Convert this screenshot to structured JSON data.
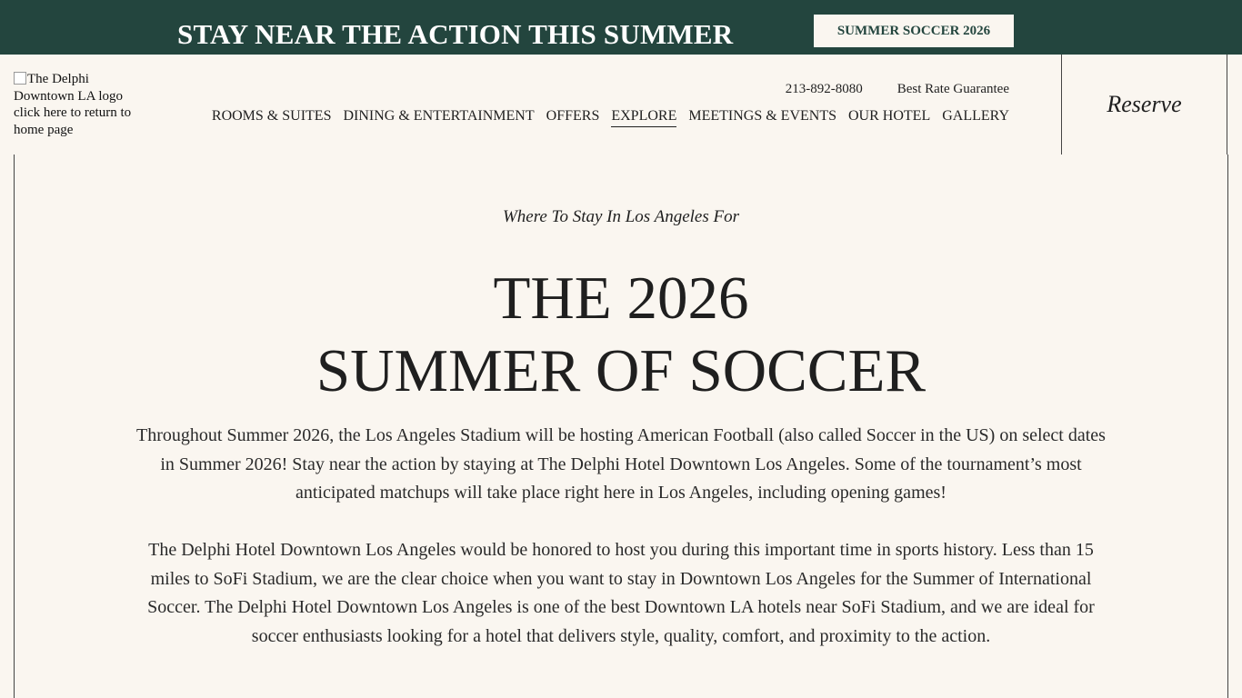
{
  "promo": {
    "headline": "STAY NEAR THE ACTION THIS SUMMER",
    "button_label": "SUMMER SOCCER 2026"
  },
  "header": {
    "logo_alt": "The Delphi Downtown LA logo click here to return to home page",
    "phone": "213-892-8080",
    "rate_link": "Best Rate Guarantee",
    "reserve_label": "Reserve"
  },
  "nav": {
    "items": [
      {
        "label": "ROOMS & SUITES"
      },
      {
        "label": "DINING & ENTERTAINMENT"
      },
      {
        "label": "OFFERS"
      },
      {
        "label": "EXPLORE"
      },
      {
        "label": "MEETINGS & EVENTS"
      },
      {
        "label": "OUR HOTEL"
      },
      {
        "label": "GALLERY"
      }
    ]
  },
  "main": {
    "eyebrow": "Where To Stay In Los Angeles For",
    "title_line1": "THE 2026",
    "title_line2": "SUMMER OF SOCCER",
    "paragraph1": "Throughout Summer 2026, the Los Angeles Stadium will be hosting American Football (also called Soccer in the US) on select dates in Summer 2026! Stay near the action by staying at The Delphi Hotel Downtown Los Angeles. Some of the tournament’s most anticipated matchups will take place right here in Los Angeles, including opening games!",
    "paragraph2": "The Delphi Hotel Downtown Los Angeles would be honored to host you during this important time in sports history. Less than 15 miles to SoFi Stadium, we are the clear choice when you want to stay in Downtown Los Angeles for the Summer of International Soccer. The Delphi Hotel Downtown Los Angeles is one of the best Downtown LA hotels near SoFi Stadium, and we are ideal for soccer enthusiasts looking for a hotel that delivers style, quality, comfort, and proximity to the action."
  },
  "colors": {
    "promo_background": "#23453e",
    "page_background": "#faf6f0",
    "text": "#1f1f1f"
  }
}
